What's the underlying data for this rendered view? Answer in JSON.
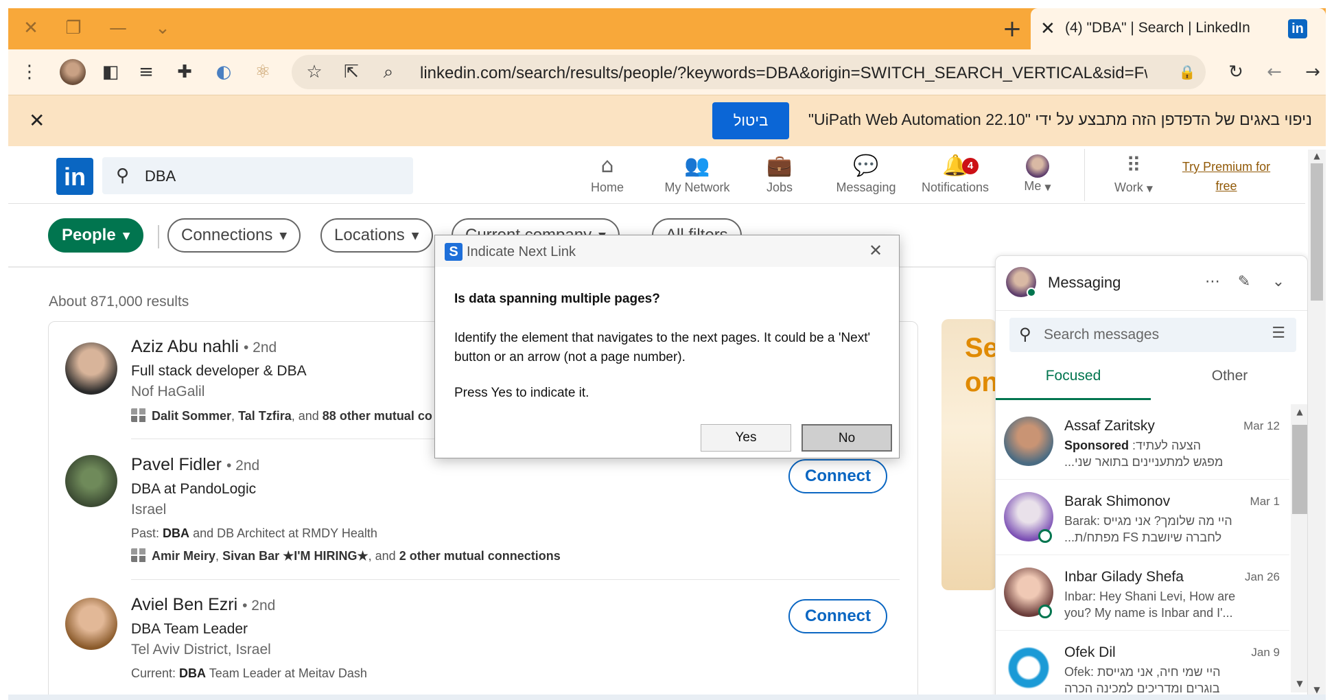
{
  "browser": {
    "tab_title": "(4) \"DBA\" | Search | LinkedIn",
    "tab_favicon": "in",
    "new_tab": "+",
    "url": "linkedin.com/search/results/people/?keywords=DBA&origin=SWITCH_SEARCH_VERTICAL&sid=Fw(",
    "theme_color": "#f8a83a"
  },
  "infobar": {
    "message": "ניפוי באגים של הדפדפן הזה מתבצע על ידי \"UiPath Web Automation 22.10\"",
    "cancel_label": "ביטול"
  },
  "linkedin": {
    "logo": "in",
    "search_value": "DBA",
    "nav": {
      "home": "Home",
      "network": "My Network",
      "jobs": "Jobs",
      "messaging": "Messaging",
      "notifications": "Notifications",
      "notifications_count": "4",
      "me": "Me",
      "work": "Work",
      "premium_line1": "Try Premium for",
      "premium_line2": "free"
    },
    "filters": {
      "people": "People",
      "connections": "Connections",
      "locations": "Locations",
      "current_company": "Current company",
      "all_filters": "All filters"
    },
    "results_count": "About 871,000 results",
    "results": [
      {
        "name": "Aziz Abu nahli",
        "degree": "• 2nd",
        "title": "Full stack developer & DBA",
        "location": "Nof HaGalil",
        "mutual_a": "Dalit Sommer",
        "mutual_b": "Tal Tzfira",
        "mutual_rest_prefix": ", and ",
        "mutual_rest": "88 other mutual co"
      },
      {
        "name": "Pavel Fidler",
        "degree": "• 2nd",
        "title": "DBA at PandoLogic",
        "location": "Israel",
        "past_label": "Past:",
        "past_key": "DBA",
        "past_rest": "and DB Architect at RMDY Health",
        "mutual_a": "Amir Meiry",
        "mutual_b": "Sivan Bar ★I'M HIRING★",
        "mutual_rest_prefix": ", and ",
        "mutual_rest": "2 other mutual connections",
        "connect": "Connect"
      },
      {
        "name": "Aviel Ben Ezri",
        "degree": "• 2nd",
        "title": "DBA Team Leader",
        "location": "Tel Aviv District, Israel",
        "current_label": "Current:",
        "current_key": "DBA",
        "current_rest": "Team Leader at Meitav Dash",
        "connect": "Connect"
      }
    ],
    "ad_text_1": "Se",
    "ad_text_2": "on"
  },
  "messaging": {
    "title": "Messaging",
    "search_placeholder": "Search messages",
    "tab_focused": "Focused",
    "tab_other": "Other",
    "conversations": [
      {
        "name": "Assaf Zaritsky",
        "date": "Mar 12",
        "line1_label": "Sponsored",
        "line1": ":הצעה לעתיד",
        "line2": "מפגש למתעניינים בתואר שני..."
      },
      {
        "name": "Barak Shimonov",
        "date": "Mar 1",
        "line1": "Barak: היי מה שלומך? אני מגייס",
        "line2": "לחברה שיושבת FS מפתח/ת..."
      },
      {
        "name": "Inbar Gilady Shefa",
        "date": "Jan 26",
        "line1": "Inbar: Hey Shani Levi, How are",
        "line2": "you? My name is Inbar and I'..."
      },
      {
        "name": "Ofek Dil",
        "date": "Jan 9",
        "line1": "Ofek: היי שמי חיה, אני מגייסת",
        "line2": "בוגרים ומדריכים למכינה הכרה"
      }
    ]
  },
  "dialog": {
    "title": "Indicate Next Link",
    "question": "Is data spanning multiple pages?",
    "body": "Identify the element that navigates to the next pages. It could be a 'Next' button or an arrow (not a page number).",
    "press": "Press Yes to indicate it.",
    "yes": "Yes",
    "no": "No"
  }
}
